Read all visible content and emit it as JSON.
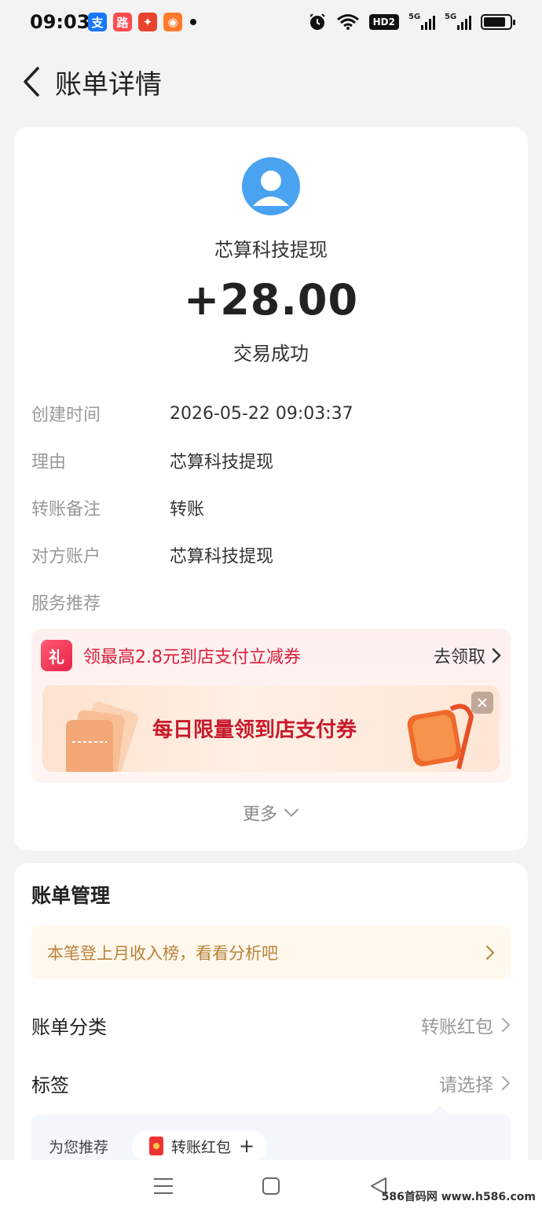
{
  "status_bar": {
    "time": "09:03",
    "apps": [
      {
        "name": "alipay-app-icon",
        "glyph": "支",
        "color": "#1677ff"
      },
      {
        "name": "map-app-icon",
        "glyph": "路",
        "color": "#ff4d4f"
      },
      {
        "name": "game-app-icon",
        "glyph": "✦",
        "color": "#e8442c"
      },
      {
        "name": "shopping-app-icon",
        "glyph": "◉",
        "color": "#ff7a2c"
      }
    ],
    "hd_label": "HD2",
    "signal_label_1": "5G",
    "signal_label_2": "5G",
    "battery_level": 0.85
  },
  "nav": {
    "title": "账单详情"
  },
  "transaction": {
    "merchant": "芯算科技提现",
    "amount": "+28.00",
    "status": "交易成功"
  },
  "details": [
    {
      "label": "创建时间",
      "value": "2026-05-22 09:03:37"
    },
    {
      "label": "理由",
      "value": "芯算科技提现"
    },
    {
      "label": "转账备注",
      "value": "转账"
    },
    {
      "label": "对方账户",
      "value": "芯算科技提现"
    },
    {
      "label": "服务推荐",
      "value": ""
    }
  ],
  "promo": {
    "gift_glyph": "礼",
    "title": "领最高2.8元到店支付立减券",
    "link": "去领取",
    "banner_text": "每日限量领到店支付券"
  },
  "more_label": "更多",
  "manage": {
    "title": "账单管理",
    "analysis_text": "本笔登上月收入榜，看看分析吧",
    "category_label": "账单分类",
    "category_value": "转账红包",
    "tag_label": "标签",
    "tag_value": "请选择",
    "recommend_label": "为您推荐",
    "recommend_tag": "转账红包",
    "recommend_plus": "+"
  },
  "watermark": "586首码网 www.h586.com",
  "colors": {
    "accent_blue": "#4aa3f0",
    "promo_red": "#d81e3a",
    "analysis_gold": "#b9823a"
  }
}
